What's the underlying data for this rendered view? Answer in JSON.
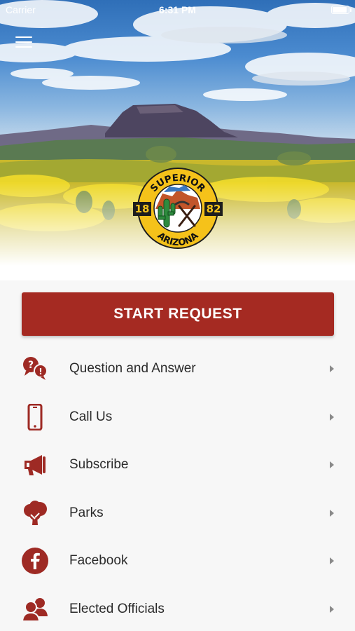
{
  "status_bar": {
    "carrier": "Carrier",
    "time": "6:31 PM",
    "battery": "full"
  },
  "logo": {
    "top_text": "SUPERIOR",
    "bottom_text": "ARIZONA",
    "year_left": "18",
    "year_right": "82"
  },
  "start_request": {
    "label": "START REQUEST"
  },
  "menu": [
    {
      "label": "Question and Answer",
      "icon": "question-bubbles-icon"
    },
    {
      "label": "Call Us",
      "icon": "phone-icon"
    },
    {
      "label": "Subscribe",
      "icon": "megaphone-icon"
    },
    {
      "label": "Parks",
      "icon": "tree-icon"
    },
    {
      "label": "Facebook",
      "icon": "facebook-icon"
    },
    {
      "label": "Elected Officials",
      "icon": "people-icon"
    }
  ],
  "colors": {
    "accent": "#a52a22",
    "icon": "#9e2a24",
    "background": "#f7f7f7",
    "logo_yellow": "#f5c21a"
  }
}
